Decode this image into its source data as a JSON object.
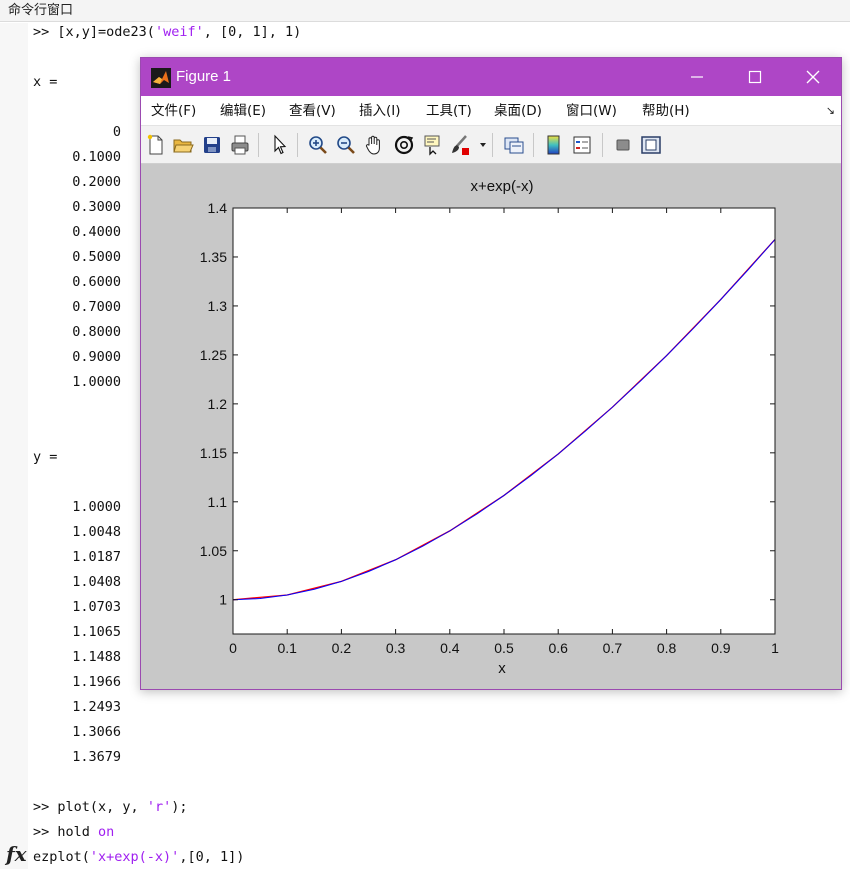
{
  "command_window": {
    "title": "命令行窗口",
    "prompt": ">>",
    "cmd1_code": " [x,y]=ode23(",
    "cmd1_str": "'weif'",
    "cmd1_rest": ", [0, 1], 1)",
    "x_label": "x =",
    "x_values": [
      "0",
      "0.1000",
      "0.2000",
      "0.3000",
      "0.4000",
      "0.5000",
      "0.6000",
      "0.7000",
      "0.8000",
      "0.9000",
      "1.0000"
    ],
    "y_label": "y =",
    "y_values": [
      "1.0000",
      "1.0048",
      "1.0187",
      "1.0408",
      "1.0703",
      "1.1065",
      "1.1488",
      "1.1966",
      "1.2493",
      "1.3066",
      "1.3679"
    ],
    "cmd2_code": " plot(x, y, ",
    "cmd2_str": "'r'",
    "cmd2_rest": ");",
    "cmd3_code": " hold ",
    "cmd3_kw": "on",
    "cmd4_code": "ezplot(",
    "cmd4_str": "'x+exp(-x)'",
    "cmd4_rest": ",[0, 1])",
    "fx_symbol": "fx"
  },
  "figure": {
    "title": "Figure 1",
    "controls": {
      "minimize": "—",
      "maximize": "☐",
      "close": "✕"
    },
    "menu": [
      "文件(F)",
      "编辑(E)",
      "查看(V)",
      "插入(I)",
      "工具(T)",
      "桌面(D)",
      "窗口(W)",
      "帮助(H)"
    ],
    "menu_overflow": "↘",
    "toolbar_icons": [
      "new-file-icon",
      "open-folder-icon",
      "save-icon",
      "print-icon",
      "pointer-icon",
      "zoom-in-icon",
      "zoom-out-icon",
      "pan-hand-icon",
      "rotate-3d-icon",
      "data-cursor-icon",
      "brush-icon",
      "link-plot-icon",
      "colorbar-icon",
      "legend-icon",
      "hide-plot-tools-icon",
      "show-plot-tools-icon"
    ],
    "accent": "#ae46c6"
  },
  "chart_data": {
    "type": "line",
    "title": "x+exp(-x)",
    "xlabel": "x",
    "ylabel": "",
    "xlim": [
      0,
      1
    ],
    "ylim": [
      0.965,
      1.4
    ],
    "xticks": [
      "0",
      "0.1",
      "0.2",
      "0.3",
      "0.4",
      "0.5",
      "0.6",
      "0.7",
      "0.8",
      "0.9",
      "1"
    ],
    "yticks": [
      "1",
      "1.05",
      "1.1",
      "1.15",
      "1.2",
      "1.25",
      "1.3",
      "1.35",
      "1.4"
    ],
    "grid": false,
    "series": [
      {
        "color": "#ff0000",
        "x": [
          0,
          0.1,
          0.2,
          0.3,
          0.4,
          0.5,
          0.6,
          0.7,
          0.8,
          0.9,
          1.0
        ],
        "y": [
          1.0,
          1.0048,
          1.0187,
          1.0408,
          1.0703,
          1.1065,
          1.1488,
          1.1966,
          1.2493,
          1.3066,
          1.3679
        ]
      },
      {
        "color": "#0000ff",
        "x": [
          0,
          0.05,
          0.1,
          0.15,
          0.2,
          0.25,
          0.3,
          0.35,
          0.4,
          0.45,
          0.5,
          0.55,
          0.6,
          0.65,
          0.7,
          0.75,
          0.8,
          0.85,
          0.9,
          0.95,
          1.0
        ],
        "y": [
          1.0,
          1.0012,
          1.0048,
          1.0107,
          1.0187,
          1.0288,
          1.0408,
          1.0547,
          1.0703,
          1.0876,
          1.1065,
          1.1269,
          1.1488,
          1.1721,
          1.1966,
          1.2224,
          1.2493,
          1.2774,
          1.3066,
          1.3367,
          1.3679
        ]
      }
    ]
  }
}
